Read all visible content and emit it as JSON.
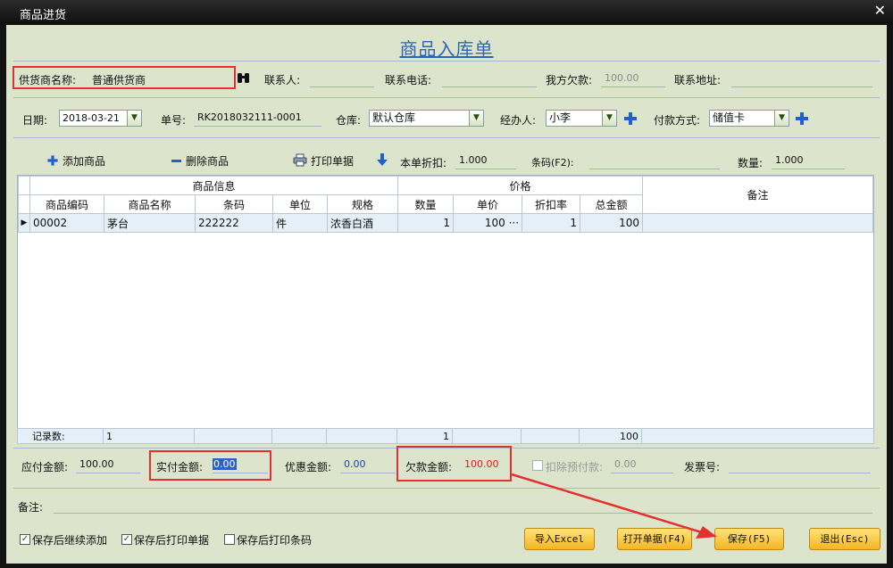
{
  "window": {
    "title": "商品进货"
  },
  "form": {
    "title": "商品入库单",
    "supplier_label": "供货商名称:",
    "supplier_value": "普通供货商",
    "contact_label": "联系人:",
    "contact_value": "",
    "phone_label": "联系电话:",
    "phone_value": "",
    "debt_label": "我方欠款:",
    "debt_value": "100.00",
    "address_label": "联系地址:",
    "address_value": "",
    "date_label": "日期:",
    "date_value": "2018-03-21",
    "order_no_label": "单号:",
    "order_no_value": "RK2018032111-0001",
    "warehouse_label": "仓库:",
    "warehouse_value": "默认仓库",
    "handler_label": "经办人:",
    "handler_value": "小李",
    "payment_label": "付款方式:",
    "payment_value": "储值卡"
  },
  "toolbar": {
    "add_label": "添加商品",
    "delete_label": "删除商品",
    "print_label": "打印单据",
    "discount_label": "本单折扣:",
    "discount_value": "1.000",
    "barcode_label": "条码(F2):",
    "barcode_value": "",
    "qty_label": "数量:",
    "qty_value": "1.000"
  },
  "grid": {
    "group_info": "商品信息",
    "group_price": "价格",
    "remark_header": "备注",
    "columns": [
      "商品编码",
      "商品名称",
      "条码",
      "单位",
      "规格",
      "数量",
      "单价",
      "折扣率",
      "总金额"
    ],
    "rows": [
      {
        "code": "00002",
        "name": "茅台",
        "barcode": "222222",
        "unit": "件",
        "spec": "浓香白酒",
        "qty": "1",
        "price": "100",
        "ellipsis": "···",
        "discount": "1",
        "total": "100",
        "remark": ""
      }
    ],
    "footer": {
      "label": "记录数:",
      "count": "1",
      "qty_sum": "1",
      "total_sum": "100"
    }
  },
  "summary": {
    "payable_label": "应付金额:",
    "payable_value": "100.00",
    "paid_label": "实付金额:",
    "paid_value": "0.00",
    "discount_label": "优惠金额:",
    "discount_value": "0.00",
    "owed_label": "欠款金额:",
    "owed_value": "100.00",
    "prepay_label": "扣除预付款:",
    "prepay_value": "0.00",
    "invoice_label": "发票号:",
    "invoice_value": "",
    "remark_label": "备注:",
    "remark_value": ""
  },
  "options": {
    "continue_add": "保存后继续添加",
    "print_after_save": "保存后打印单据",
    "print_barcode": "保存后打印条码"
  },
  "buttons": {
    "import": "导入Excel",
    "open": "打开单据(F4)",
    "save": "保存(F5)",
    "exit": "退出(Esc)"
  },
  "colors": {
    "accent": "#2b67b8",
    "warning": "#e53030",
    "button": "#f4b623",
    "background": "#dde4cc"
  }
}
